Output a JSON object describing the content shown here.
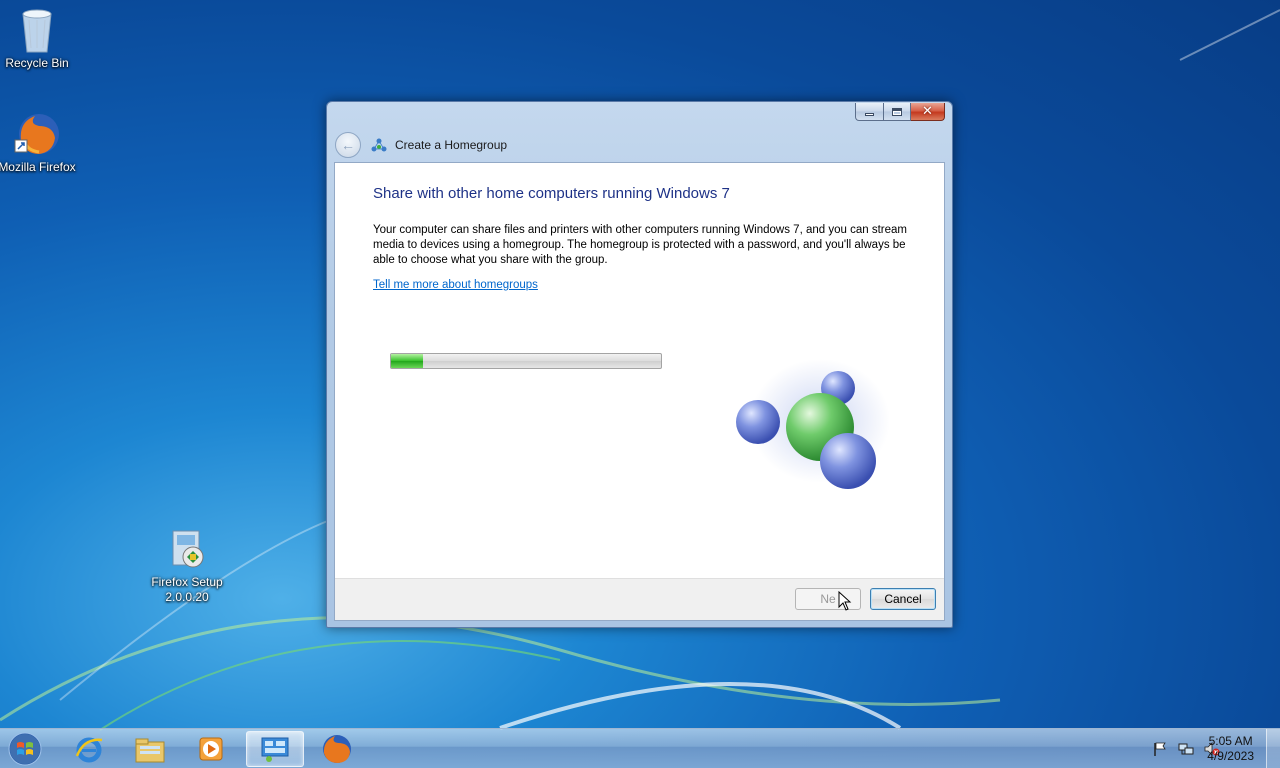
{
  "desktop": {
    "icons": [
      {
        "label": "Recycle Bin",
        "icon": "recycle-bin-icon"
      },
      {
        "label": "Mozilla Firefox",
        "icon": "firefox-icon"
      },
      {
        "label": "Firefox Setup 2.0.0.20",
        "icon": "installer-icon"
      }
    ]
  },
  "window": {
    "title": "Create a Homegroup",
    "heading": "Share with other home computers running Windows 7",
    "description": "Your computer can share files and printers with other computers running Windows 7, and you can stream media to devices using a homegroup. The homegroup is protected with a password, and you'll always be able to choose what you share with the group.",
    "link": "Tell me more about homegroups",
    "progress_fraction": 0.12,
    "buttons": {
      "next": "Next",
      "cancel": "Cancel"
    },
    "next_visible_text": "Ne"
  },
  "taskbar": {
    "items": [
      "start-orb",
      "internet-explorer-icon",
      "windows-explorer-icon",
      "media-player-icon",
      "homegroup-control-panel-icon",
      "firefox-icon"
    ],
    "tray_icons": [
      "action-center-flag-icon",
      "network-icon",
      "volume-muted-icon"
    ],
    "clock": {
      "time": "5:05 AM",
      "date": "4/9/2023"
    }
  },
  "colors": {
    "heading": "#1e3287",
    "link": "#0066cc",
    "progress": "#36c12a"
  }
}
